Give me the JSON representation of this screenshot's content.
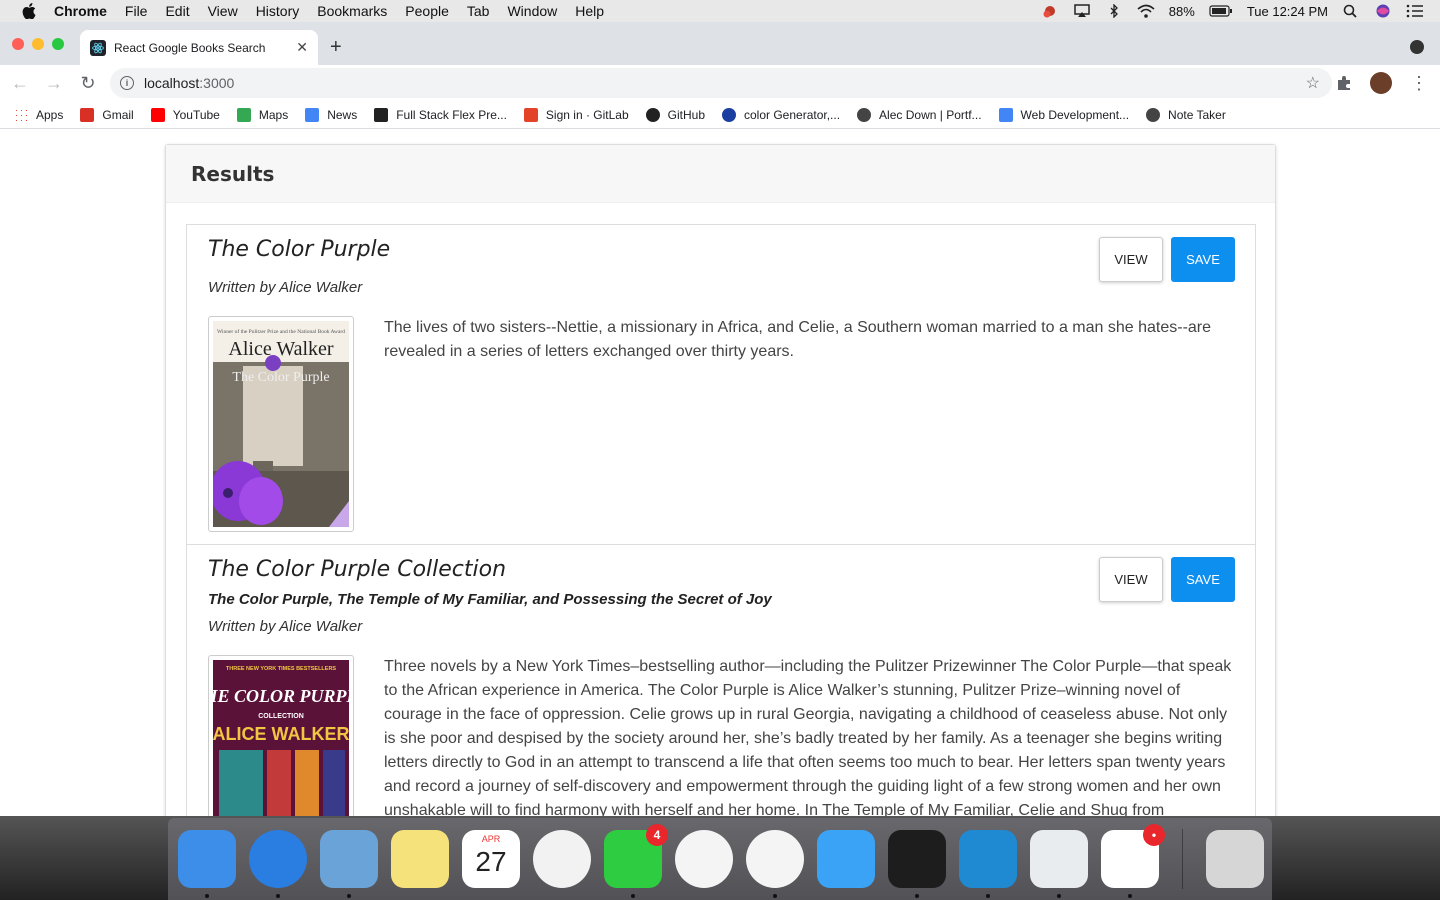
{
  "menubar": {
    "app": "Chrome",
    "items": [
      "File",
      "Edit",
      "View",
      "History",
      "Bookmarks",
      "People",
      "Tab",
      "Window",
      "Help"
    ],
    "battery": "88%",
    "clock": "Tue 12:24 PM"
  },
  "browser": {
    "tab_title": "React Google Books Search",
    "url_host": "localhost",
    "url_port": ":3000",
    "bookmarks": [
      {
        "label": "Apps",
        "icon": "apps-grid-icon",
        "color": "#4285f4"
      },
      {
        "label": "Gmail",
        "icon": "gmail-icon",
        "color": "#d93025"
      },
      {
        "label": "YouTube",
        "icon": "youtube-icon",
        "color": "#ff0000"
      },
      {
        "label": "Maps",
        "icon": "maps-icon",
        "color": "#34a853"
      },
      {
        "label": "News",
        "icon": "news-icon",
        "color": "#4285f4"
      },
      {
        "label": "Full Stack Flex Pre...",
        "icon": "doc-icon",
        "color": "#222222"
      },
      {
        "label": "Sign in · GitLab",
        "icon": "gitlab-icon",
        "color": "#e24329"
      },
      {
        "label": "GitHub",
        "icon": "github-icon",
        "color": "#222222"
      },
      {
        "label": "color Generator,...",
        "icon": "color-icon",
        "color": "#1a3fa0"
      },
      {
        "label": "Alec Down | Portf...",
        "icon": "globe-icon",
        "color": "#444444"
      },
      {
        "label": "Web Development...",
        "icon": "docs-icon",
        "color": "#4285f4"
      },
      {
        "label": "Note Taker",
        "icon": "globe-icon",
        "color": "#444444"
      }
    ]
  },
  "page": {
    "header": "Results",
    "view_label": "VIEW",
    "save_label": "SAVE",
    "books": [
      {
        "title": "The Color Purple",
        "subtitle": "",
        "author": "Written by Alice Walker",
        "description": "The lives of two sisters--Nettie, a missionary in Africa, and Celie, a Southern woman married to a man she hates--are revealed in a series of letters exchanged over thirty years.",
        "cover_top": "Winner of the Pulitzer Prize and the National Book Award",
        "cover_author": "Alice Walker",
        "cover_title": "The Color Purple"
      },
      {
        "title": "The Color Purple Collection",
        "subtitle": "The Color Purple, The Temple of My Familiar, and Possessing the Secret of Joy",
        "author": "Written by Alice Walker",
        "description": "Three novels by a New York Times–bestselling author—including the Pulitzer Prizewinner The Color Purple—that speak to the African experience in America. The Color Purple is Alice Walker’s stunning, Pulitzer Prize–winning novel of courage in the face of oppression. Celie grows up in rural Georgia, navigating a childhood of ceaseless abuse. Not only is she poor and despised by the society around her, she’s badly treated by her family. As a teenager she begins writing letters directly to God in an attempt to transcend a life that often seems too much to bear. Her letters span twenty years and record a journey of self-discovery and empowerment through the guiding light of a few strong women and her own unshakable will to find harmony with herself and her home. In The Temple of My Familiar, Celie and Shug from",
        "cover_top": "THREE NEW YORK TIMES BESTSELLERS",
        "cover_title": "THE COLOR PURPLE",
        "cover_sub": "COLLECTION",
        "cover_author": "ALICE WALKER"
      }
    ]
  },
  "dock": {
    "apps": [
      {
        "name": "finder-icon",
        "color": "#3d8ee8"
      },
      {
        "name": "safari-icon",
        "color": "#2a7de1"
      },
      {
        "name": "mail-icon",
        "color": "#6aa3d8"
      },
      {
        "name": "notes-icon",
        "color": "#f6e27a"
      },
      {
        "name": "calendar-icon",
        "color": "#ffffff",
        "month": "APR",
        "day": "27"
      },
      {
        "name": "photos-icon",
        "color": "#f2f2f2"
      },
      {
        "name": "facetime-icon",
        "color": "#2ecc40",
        "badge": "4"
      },
      {
        "name": "itunes-icon",
        "color": "#f4f4f4"
      },
      {
        "name": "chrome-icon",
        "color": "#f4f4f4"
      },
      {
        "name": "messages-icon",
        "color": "#3ba3f6"
      },
      {
        "name": "terminal-icon",
        "color": "#1d1d1d"
      },
      {
        "name": "vscode-icon",
        "color": "#1f8ad2"
      },
      {
        "name": "maps-app-icon",
        "color": "#e9ecef"
      },
      {
        "name": "slack-icon",
        "color": "#ffffff",
        "badge": "•"
      },
      {
        "name": "trash-icon",
        "color": "#d6d6d6"
      }
    ]
  }
}
